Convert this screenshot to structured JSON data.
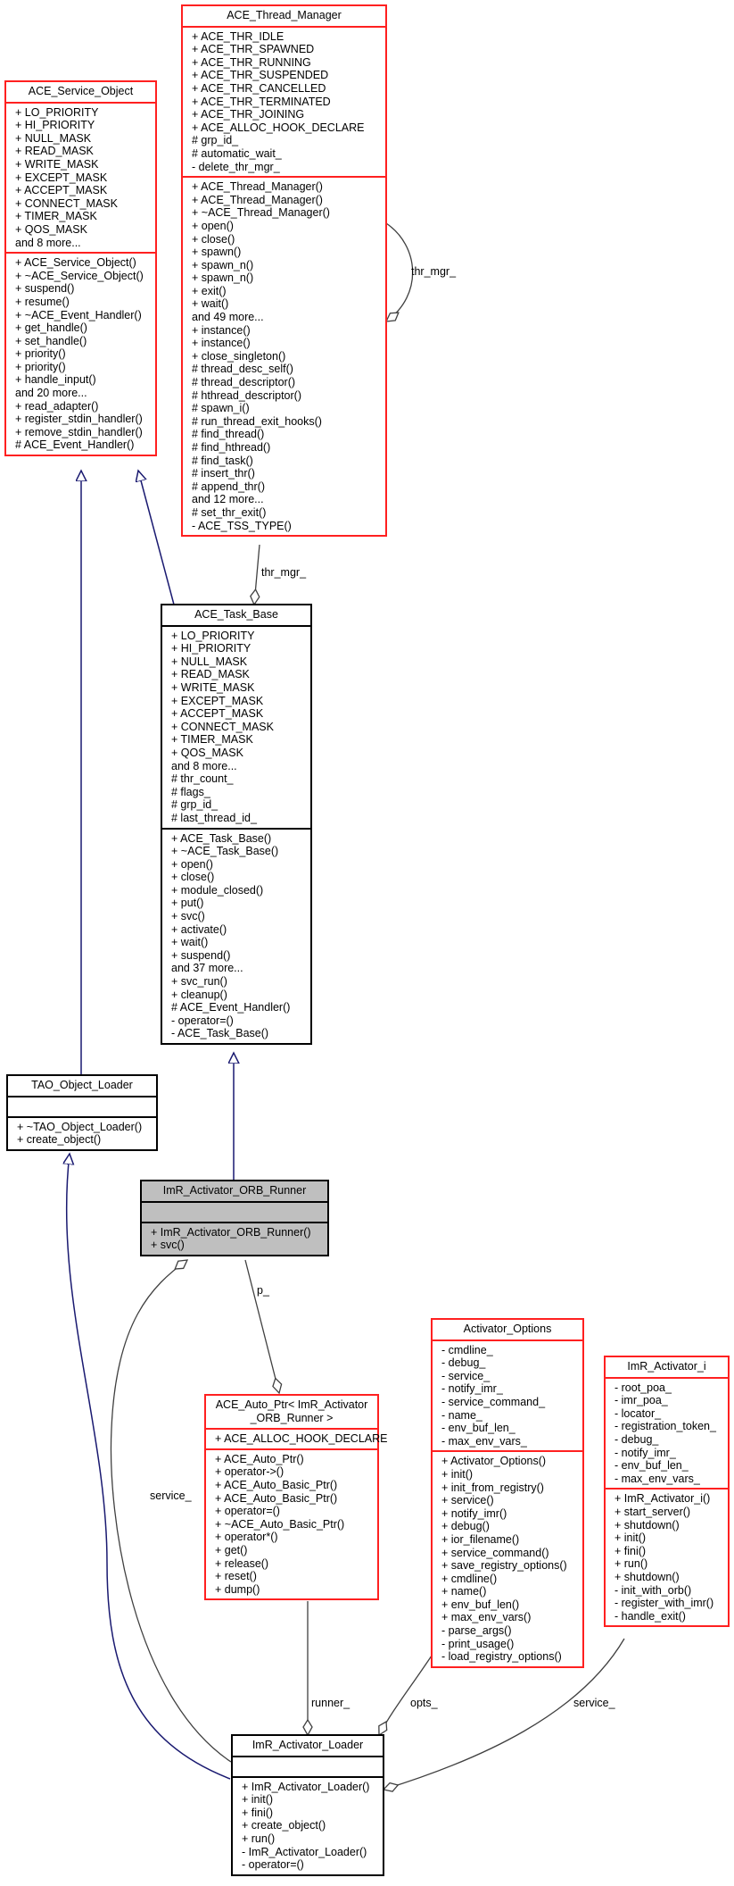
{
  "diagram": {
    "type": "collaboration-graph",
    "colors": {
      "class_border_documented": "#000000",
      "class_border_undocumented": "#ff2020",
      "focus_class_fill": "#bfbfbf",
      "inheritance_edge": "#191970",
      "usage_edge": "#404040"
    },
    "nodes": {
      "ace_service_object": {
        "name": "ACE_Service_Object",
        "attributes": [
          "+ LO_PRIORITY",
          "+ HI_PRIORITY",
          "+ NULL_MASK",
          "+ READ_MASK",
          "+ WRITE_MASK",
          "+ EXCEPT_MASK",
          "+ ACCEPT_MASK",
          "+ CONNECT_MASK",
          "+ TIMER_MASK",
          "+ QOS_MASK",
          "and 8 more..."
        ],
        "operations": [
          "+ ACE_Service_Object()",
          "+ ~ACE_Service_Object()",
          "+ suspend()",
          "+ resume()",
          "+ ~ACE_Event_Handler()",
          "+ get_handle()",
          "+ set_handle()",
          "+ priority()",
          "+ priority()",
          "+ handle_input()",
          "and 20 more...",
          "+ read_adapter()",
          "+ register_stdin_handler()",
          "+ remove_stdin_handler()",
          "# ACE_Event_Handler()"
        ]
      },
      "ace_thread_manager": {
        "name": "ACE_Thread_Manager",
        "attributes": [
          "+ ACE_THR_IDLE",
          "+ ACE_THR_SPAWNED",
          "+ ACE_THR_RUNNING",
          "+ ACE_THR_SUSPENDED",
          "+ ACE_THR_CANCELLED",
          "+ ACE_THR_TERMINATED",
          "+ ACE_THR_JOINING",
          "+ ACE_ALLOC_HOOK_DECLARE",
          "# grp_id_",
          "# automatic_wait_",
          "- delete_thr_mgr_"
        ],
        "operations": [
          "+ ACE_Thread_Manager()",
          "+ ACE_Thread_Manager()",
          "+ ~ACE_Thread_Manager()",
          "+ open()",
          "+ close()",
          "+ spawn()",
          "+ spawn_n()",
          "+ spawn_n()",
          "+ exit()",
          "+ wait()",
          "and 49 more...",
          "+ instance()",
          "+ instance()",
          "+ close_singleton()",
          "# thread_desc_self()",
          "# thread_descriptor()",
          "# hthread_descriptor()",
          "# spawn_i()",
          "# run_thread_exit_hooks()",
          "# find_thread()",
          "# find_hthread()",
          "# find_task()",
          "# insert_thr()",
          "# append_thr()",
          "and 12 more...",
          "# set_thr_exit()",
          "- ACE_TSS_TYPE()"
        ]
      },
      "ace_task_base": {
        "name": "ACE_Task_Base",
        "attributes": [
          "+ LO_PRIORITY",
          "+ HI_PRIORITY",
          "+ NULL_MASK",
          "+ READ_MASK",
          "+ WRITE_MASK",
          "+ EXCEPT_MASK",
          "+ ACCEPT_MASK",
          "+ CONNECT_MASK",
          "+ TIMER_MASK",
          "+ QOS_MASK",
          "and 8 more...",
          "# thr_count_",
          "# flags_",
          "# grp_id_",
          "# last_thread_id_"
        ],
        "operations": [
          "+ ACE_Task_Base()",
          "+ ~ACE_Task_Base()",
          "+ open()",
          "+ close()",
          "+ module_closed()",
          "+ put()",
          "+ svc()",
          "+ activate()",
          "+ wait()",
          "+ suspend()",
          "and 37 more...",
          "+ svc_run()",
          "+ cleanup()",
          "# ACE_Event_Handler()",
          "- operator=()",
          "- ACE_Task_Base()"
        ]
      },
      "tao_object_loader": {
        "name": "TAO_Object_Loader",
        "attributes": [],
        "operations": [
          "+ ~TAO_Object_Loader()",
          "+ create_object()"
        ]
      },
      "imr_activator_orb_runner": {
        "name": "ImR_Activator_ORB_Runner",
        "attributes": [],
        "operations": [
          "+ ImR_Activator_ORB_Runner()",
          "+ svc()"
        ]
      },
      "ace_auto_ptr": {
        "name": "ACE_Auto_Ptr< ImR_Activator\n_ORB_Runner >",
        "attributes": [
          "+ ACE_ALLOC_HOOK_DECLARE"
        ],
        "operations": [
          "+ ACE_Auto_Ptr()",
          "+ operator->()",
          "+ ACE_Auto_Basic_Ptr()",
          "+ ACE_Auto_Basic_Ptr()",
          "+ operator=()",
          "+ ~ACE_Auto_Basic_Ptr()",
          "+ operator*()",
          "+ get()",
          "+ release()",
          "+ reset()",
          "+ dump()"
        ]
      },
      "activator_options": {
        "name": "Activator_Options",
        "attributes": [
          "- cmdline_",
          "- debug_",
          "- service_",
          "- notify_imr_",
          "- service_command_",
          "- name_",
          "- env_buf_len_",
          "- max_env_vars_"
        ],
        "operations": [
          "+ Activator_Options()",
          "+ init()",
          "+ init_from_registry()",
          "+ service()",
          "+ notify_imr()",
          "+ debug()",
          "+ ior_filename()",
          "+ service_command()",
          "+ save_registry_options()",
          "+ cmdline()",
          "+ name()",
          "+ env_buf_len()",
          "+ max_env_vars()",
          "- parse_args()",
          "- print_usage()",
          "- load_registry_options()"
        ]
      },
      "imr_activator_i": {
        "name": "ImR_Activator_i",
        "attributes": [
          "- root_poa_",
          "- imr_poa_",
          "- locator_",
          "- registration_token_",
          "- debug_",
          "- notify_imr_",
          "- env_buf_len_",
          "- max_env_vars_"
        ],
        "operations": [
          "+ ImR_Activator_i()",
          "+ start_server()",
          "+ shutdown()",
          "+ init()",
          "+ fini()",
          "+ run()",
          "+ shutdown()",
          "- init_with_orb()",
          "- register_with_imr()",
          "- handle_exit()"
        ]
      },
      "imr_activator_loader": {
        "name": "ImR_Activator_Loader",
        "attributes": [],
        "operations": [
          "+ ImR_Activator_Loader()",
          "+ init()",
          "+ fini()",
          "+ create_object()",
          "+ run()",
          "- ImR_Activator_Loader()",
          "- operator=()"
        ]
      }
    },
    "edges": [
      {
        "from": "ace_service_object",
        "to": "ace_task_base",
        "kind": "inheritance",
        "label": ""
      },
      {
        "from": "ace_service_object",
        "to": "tao_object_loader",
        "kind": "inheritance",
        "label": ""
      },
      {
        "from": "ace_thread_manager",
        "to": "ace_thread_manager",
        "kind": "usage",
        "label": "thr_mgr_"
      },
      {
        "from": "ace_thread_manager",
        "to": "ace_task_base",
        "kind": "usage",
        "label": "thr_mgr_"
      },
      {
        "from": "ace_task_base",
        "to": "imr_activator_orb_runner",
        "kind": "inheritance",
        "label": ""
      },
      {
        "from": "tao_object_loader",
        "to": "imr_activator_loader",
        "kind": "inheritance",
        "label": ""
      },
      {
        "from": "imr_activator_orb_runner",
        "to": "ace_auto_ptr",
        "kind": "usage",
        "label": "p_"
      },
      {
        "from": "imr_activator_loader",
        "to": "imr_activator_orb_runner",
        "kind": "usage",
        "label": "service_"
      },
      {
        "from": "ace_auto_ptr",
        "to": "imr_activator_loader",
        "kind": "usage",
        "label": "runner_"
      },
      {
        "from": "activator_options",
        "to": "imr_activator_loader",
        "kind": "usage",
        "label": "opts_"
      },
      {
        "from": "imr_activator_i",
        "to": "imr_activator_loader",
        "kind": "usage",
        "label": "service_"
      }
    ]
  }
}
